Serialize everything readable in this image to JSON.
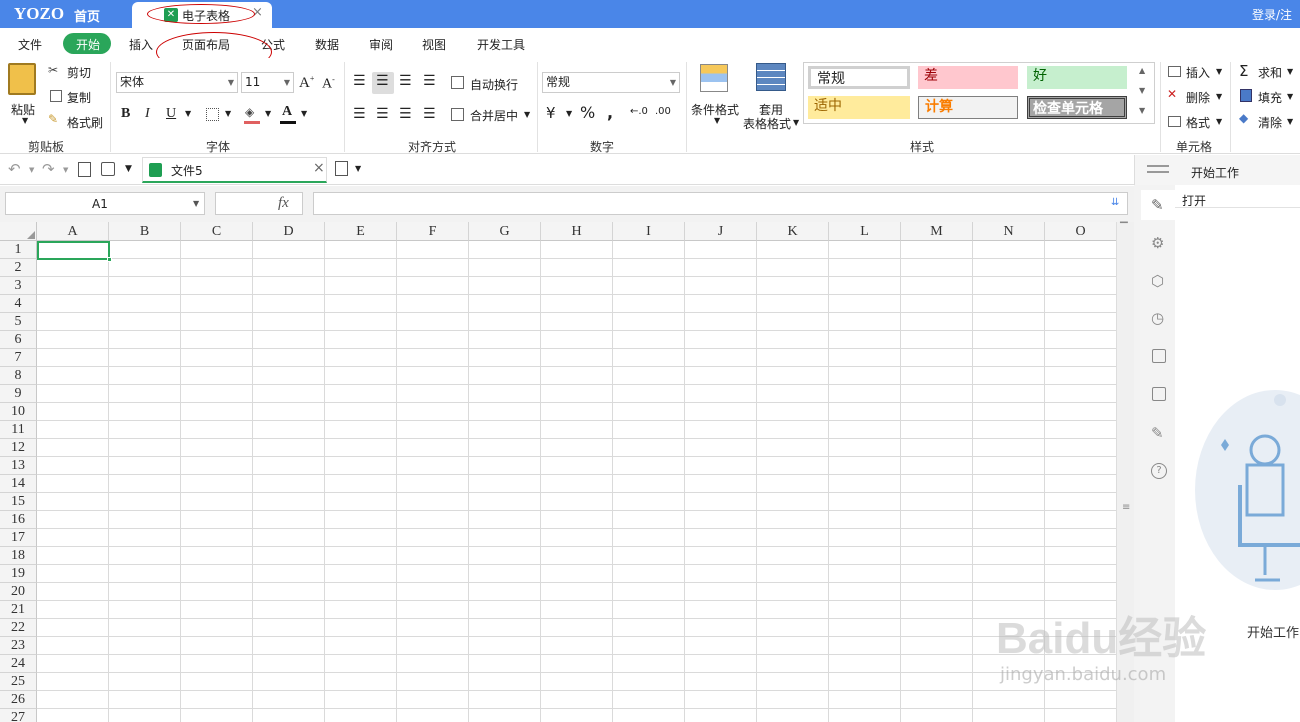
{
  "titlebar": {
    "logo": "YOZO",
    "home": "首页",
    "doc_tab": "电子表格",
    "login": "登录/注"
  },
  "menu": [
    "文件",
    "开始",
    "插入",
    "页面布局",
    "公式",
    "数据",
    "审阅",
    "视图",
    "开发工具"
  ],
  "clipboard": {
    "paste": "粘贴",
    "cut": "剪切",
    "copy": "复制",
    "format_painter": "格式刷",
    "group": "剪贴板"
  },
  "font": {
    "name": "宋体",
    "size": "11",
    "group": "字体"
  },
  "alignment": {
    "wrap": "自动换行",
    "merge": "合并居中",
    "group": "对齐方式"
  },
  "number": {
    "format": "常规",
    "group": "数字"
  },
  "styles": {
    "cond_format": "条件格式",
    "table_format_1": "套用",
    "table_format_2": "表格格式",
    "normal": "常规",
    "bad": "差",
    "good": "好",
    "neutral": "适中",
    "calc": "计算",
    "check": "检查单元格",
    "group": "样式"
  },
  "cells": {
    "insert": "插入",
    "delete": "删除",
    "format": "格式",
    "group": "单元格"
  },
  "editing": {
    "sum": "求和",
    "fill": "填充",
    "clear": "清除"
  },
  "quickbar": {
    "file_tab": "文件5"
  },
  "formula_bar": {
    "name_box": "A1",
    "fx": "fx"
  },
  "columns": [
    "A",
    "B",
    "C",
    "D",
    "E",
    "F",
    "G",
    "H",
    "I",
    "J",
    "K",
    "L",
    "M",
    "N",
    "O"
  ],
  "rows": [
    "1",
    "2",
    "3",
    "4",
    "5",
    "6",
    "7",
    "8",
    "9",
    "10",
    "11",
    "12",
    "13",
    "14",
    "15",
    "16",
    "17",
    "18",
    "19",
    "20",
    "21",
    "22",
    "23",
    "24",
    "25",
    "26",
    "27"
  ],
  "right_panel": {
    "title": "开始工作",
    "open": "打开",
    "footer": "开始工作"
  },
  "watermark": {
    "brand": "Baidu经验",
    "url": "jingyan.baidu.com"
  },
  "colors": {
    "accent_blue": "#4a86e8",
    "accent_green": "#2aa65a"
  }
}
